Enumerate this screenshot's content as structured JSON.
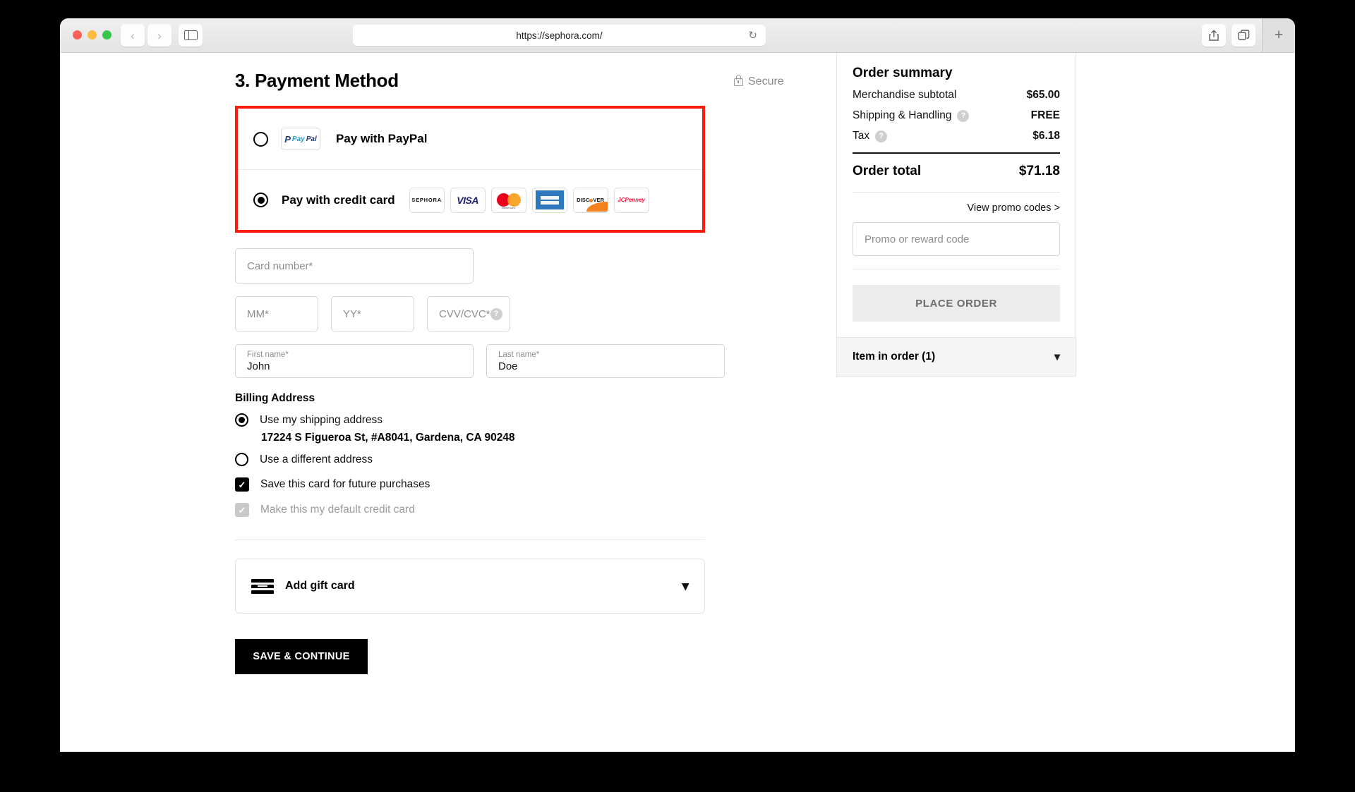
{
  "browser": {
    "url": "https://sephora.com/",
    "reload_icon": "reload-icon",
    "back_icon": "‹",
    "forward_icon": "›",
    "sidebar_icon": "sidebar-icon",
    "share_icon": "share-icon",
    "tabs_icon": "tabs-icon",
    "new_tab_icon": "+"
  },
  "page": {
    "title": "3. Payment Method",
    "secure_label": "Secure"
  },
  "payment_options": {
    "paypal": {
      "label": "Pay with PayPal",
      "selected": false,
      "logo_p": "P",
      "logo_pay": "Pay",
      "logo_pal": "Pal"
    },
    "credit_card": {
      "label": "Pay with credit card",
      "selected": true,
      "logos": [
        {
          "name": "sephora-logo",
          "text": "SEPHORA"
        },
        {
          "name": "visa-logo",
          "text": "VISA"
        },
        {
          "name": "mastercard-logo",
          "text": "mastercard"
        },
        {
          "name": "amex-logo",
          "text": "AMERICAN EXPRESS"
        },
        {
          "name": "discover-logo",
          "text": "DISC VER"
        },
        {
          "name": "jcpenney-logo",
          "text": "JCPenney"
        }
      ]
    }
  },
  "card_form": {
    "card_number_placeholder": "Card number*",
    "mm_placeholder": "MM*",
    "yy_placeholder": "YY*",
    "cvv_placeholder": "CVV/CVC*",
    "cvv_help_icon": "?",
    "first_name_label": "First name*",
    "first_name_value": "John",
    "last_name_label": "Last name*",
    "last_name_value": "Doe"
  },
  "billing": {
    "title": "Billing Address",
    "use_shipping_label": "Use my shipping address",
    "use_shipping_selected": true,
    "shipping_address": "17224 S Figueroa St, #A8041, Gardena, CA 90248",
    "different_address_label": "Use a different address",
    "different_address_selected": false,
    "save_card_label": "Save this card for future purchases",
    "save_card_checked": true,
    "default_card_label": "Make this my default credit card",
    "default_card_checked": true,
    "default_card_disabled": true,
    "check_mark": "✓"
  },
  "gift_card": {
    "label": "Add gift card",
    "chevron": "⌄"
  },
  "actions": {
    "save_continue": "SAVE & CONTINUE"
  },
  "order_summary": {
    "title": "Order summary",
    "lines": [
      {
        "label": "Merchandise subtotal",
        "value": "$65.00",
        "has_help": false
      },
      {
        "label": "Shipping & Handling",
        "value": "FREE",
        "has_help": true
      },
      {
        "label": "Tax",
        "value": "$6.18",
        "has_help": true
      }
    ],
    "total_label": "Order total",
    "total_value": "$71.18",
    "view_promo_label": "View promo codes >",
    "promo_placeholder": "Promo or reward code",
    "place_order_label": "PLACE ORDER",
    "item_in_order_label": "Item in order (1)",
    "item_chevron": "⌄",
    "help_icon": "?"
  },
  "colors": {
    "highlight": "#ff1a0f",
    "accent_black": "#000000",
    "paypal_blue": "#253b80",
    "visa_blue": "#1a1f71"
  }
}
